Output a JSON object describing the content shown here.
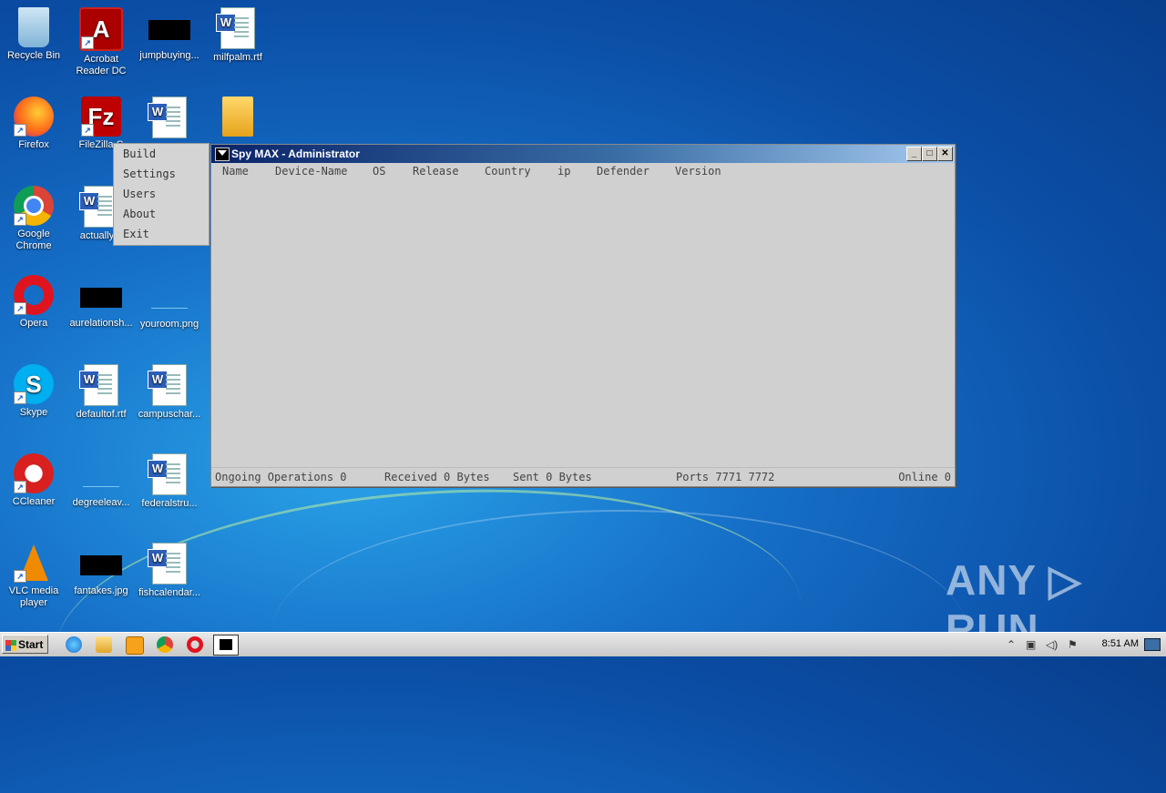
{
  "desktop": {
    "icons": [
      {
        "label": "Recycle Bin"
      },
      {
        "label": "Acrobat Reader DC"
      },
      {
        "label": "jumpbuying..."
      },
      {
        "label": "milfpalm.rtf"
      },
      {
        "label": "Firefox"
      },
      {
        "label": "FileZilla C"
      },
      {
        "label": "Google Chrome"
      },
      {
        "label": "actuallyrc"
      },
      {
        "label": "Opera"
      },
      {
        "label": "aurelationsh..."
      },
      {
        "label": "youroom.png"
      },
      {
        "label": "Skype"
      },
      {
        "label": "defaultof.rtf"
      },
      {
        "label": "campuschar..."
      },
      {
        "label": "CCleaner"
      },
      {
        "label": "degreeleav..."
      },
      {
        "label": "federalstru..."
      },
      {
        "label": "VLC media player"
      },
      {
        "label": "fantakes.jpg"
      },
      {
        "label": "fishcalendar..."
      }
    ]
  },
  "context_menu": {
    "items": [
      "Build",
      "Settings",
      "Users",
      "About",
      "Exit"
    ]
  },
  "window": {
    "title": "Spy MAX - Administrator",
    "buttons": {
      "minimize": "_",
      "maximize": "□",
      "close": "✕"
    },
    "columns": [
      "Name",
      "Device-Name",
      "OS",
      "Release",
      "Country",
      "ip",
      "Defender",
      "Version"
    ],
    "status": {
      "ongoing": "Ongoing Operations 0",
      "received": "Received 0 Bytes",
      "sent": "Sent 0 Bytes",
      "ports": "Ports 7771 7772",
      "online": "Online 0"
    }
  },
  "watermark": "ANY ▷ RUN",
  "taskbar": {
    "start_label": "Start",
    "clock": "8:51 AM"
  },
  "colors": {
    "titlebar_start": "#0a246a",
    "titlebar_end": "#a6caf0",
    "window_bg": "#d0d0d0"
  }
}
